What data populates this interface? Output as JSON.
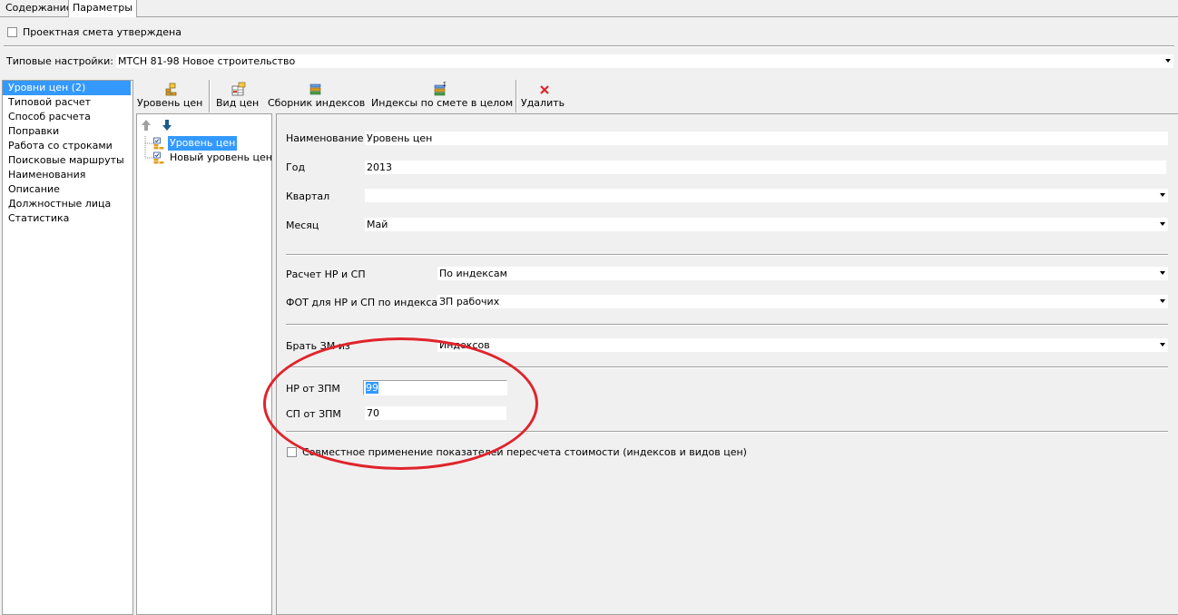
{
  "tabs": [
    "Содержание",
    "Параметры"
  ],
  "approved": {
    "label": "Проектная смета утверждена"
  },
  "typical": {
    "label": "Типовые настройки:",
    "value": "МТСН 81-98 Новое строительство"
  },
  "nav": {
    "items": [
      "Уровни цен (2)",
      "Типовой расчет",
      "Способ расчета",
      "Поправки",
      "Работа со строками",
      "Поисковые маршруты",
      "Наименования",
      "Описание",
      "Должностные лица",
      "Статистика"
    ]
  },
  "toolbar": {
    "price_level": "Уровень цен",
    "price_type": "Вид цен",
    "index_collection": "Сборник индексов",
    "estimate_indexes": "Индексы по смете в целом",
    "delete": "Удалить"
  },
  "tree": {
    "nodes": [
      "Уровень цен",
      "Новый уровень цен"
    ]
  },
  "form": {
    "name": {
      "label": "Наименование",
      "value": "Уровень цен"
    },
    "year": {
      "label": "Год",
      "value": "2013"
    },
    "quarter": {
      "label": "Квартал",
      "value": ""
    },
    "month": {
      "label": "Месяц",
      "value": "Май"
    },
    "nr_sp_calc": {
      "label": "Расчет НР и СП",
      "value": "По индексам"
    },
    "fot": {
      "label": "ФОТ для НР и СП по индексам",
      "value": "ЗП рабочих"
    },
    "take_zm": {
      "label": "Брать ЗМ из",
      "value": "Индексов"
    },
    "nr_zpm": {
      "label": "НР от ЗПМ",
      "value": "99"
    },
    "sp_zpm": {
      "label": "СП от ЗПМ",
      "value": "70"
    },
    "combined": {
      "label": "Совместное применение показателей пересчета стоимости (индексов и видов цен)"
    }
  },
  "colors": {
    "selection": "#3399ff",
    "annotation": "#e0242c"
  }
}
